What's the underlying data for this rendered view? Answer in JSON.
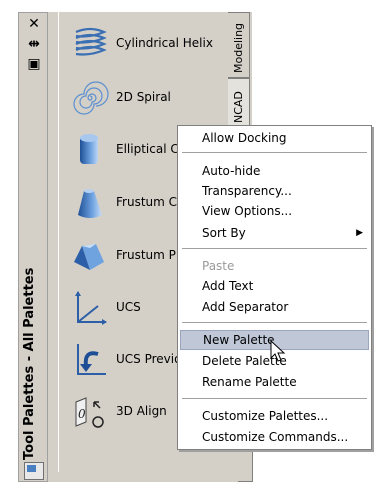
{
  "palette": {
    "title": "Tool Palettes - All Palettes",
    "tabs": [
      {
        "label": "Modeling"
      },
      {
        "label": "NCAD"
      }
    ],
    "tools": [
      {
        "label": "Cylindrical Helix",
        "icon": "helix-icon"
      },
      {
        "label": "2D Spiral",
        "icon": "spiral-icon"
      },
      {
        "label": "Elliptical Cy",
        "icon": "elliptical-cylinder-icon"
      },
      {
        "label": "Frustum C",
        "icon": "frustum-cone-icon"
      },
      {
        "label": "Frustum P",
        "icon": "frustum-pyramid-icon"
      },
      {
        "label": "UCS",
        "icon": "ucs-icon"
      },
      {
        "label": "UCS Previo",
        "icon": "ucs-previous-icon"
      },
      {
        "label": "3D Align",
        "icon": "3d-align-icon"
      }
    ],
    "strip_buttons": [
      {
        "glyph": "✕",
        "icon": "close-icon"
      },
      {
        "glyph": "⇹",
        "icon": "auto-hide-icon"
      },
      {
        "glyph": "▣",
        "icon": "properties-icon"
      }
    ]
  },
  "context_menu": {
    "items": [
      {
        "label": "Allow Docking"
      },
      {
        "label": "Auto-hide"
      },
      {
        "label": "Transparency..."
      },
      {
        "label": "View Options..."
      },
      {
        "label": "Sort By",
        "submenu": true
      },
      {
        "label": "Paste",
        "disabled": true
      },
      {
        "label": "Add Text"
      },
      {
        "label": "Add Separator"
      },
      {
        "label": "New Palette",
        "highlighted": true
      },
      {
        "label": "Delete Palette"
      },
      {
        "label": "Rename Palette"
      },
      {
        "label": "Customize Palettes..."
      },
      {
        "label": "Customize Commands..."
      }
    ]
  },
  "colors": {
    "panel": "#d4d0c8",
    "highlight": "#c0c8d8"
  }
}
